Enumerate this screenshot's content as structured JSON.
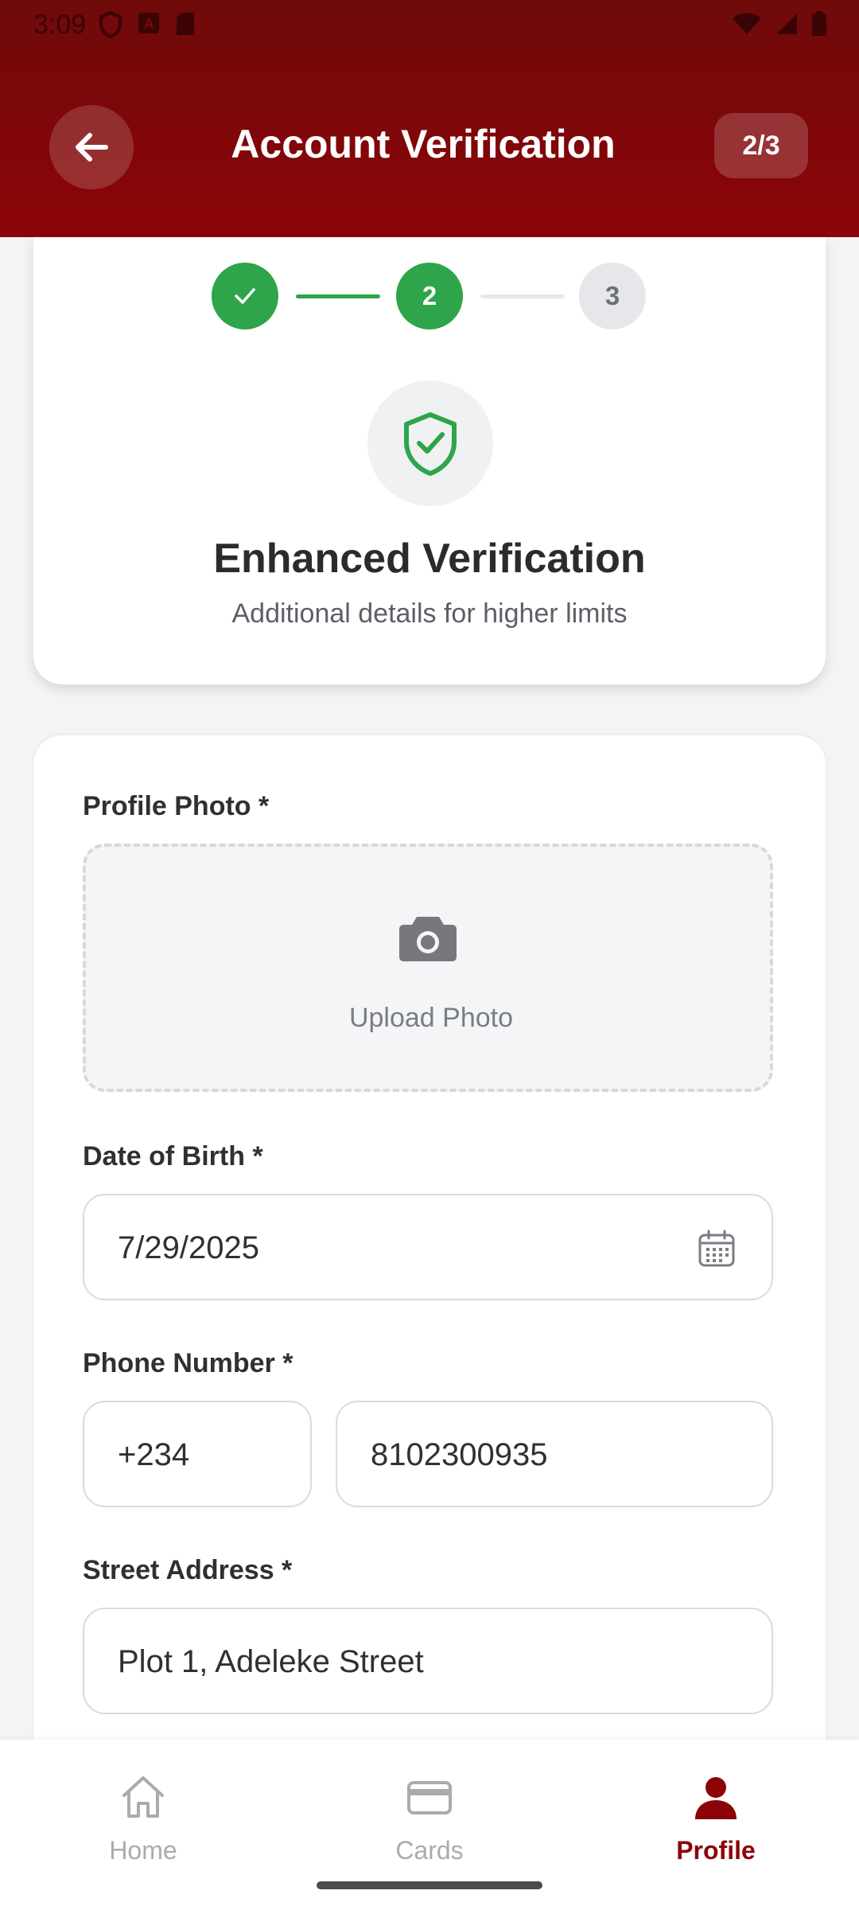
{
  "status_bar": {
    "time": "3:09"
  },
  "header": {
    "title": "Account Verification",
    "step_badge": "2/3"
  },
  "stepper": {
    "steps": [
      {
        "label": "",
        "state": "done"
      },
      {
        "label": "2",
        "state": "active"
      },
      {
        "label": "3",
        "state": "todo"
      }
    ]
  },
  "intro": {
    "title": "Enhanced Verification",
    "subtitle": "Additional details for higher limits"
  },
  "form": {
    "profile_photo_label": "Profile Photo *",
    "upload_label": "Upload Photo",
    "dob_label": "Date of Birth *",
    "dob_value": "7/29/2025",
    "phone_label": "Phone Number *",
    "phone_code": "+234",
    "phone_number": "8102300935",
    "address_label": "Street Address *",
    "address_value": "Plot 1, Adeleke Street"
  },
  "bottom_nav": {
    "items": [
      {
        "label": "Home",
        "icon": "home-icon"
      },
      {
        "label": "Cards",
        "icon": "card-icon"
      },
      {
        "label": "Profile",
        "icon": "profile-icon",
        "active": true
      }
    ]
  },
  "colors": {
    "brand": "#8c0408",
    "success": "#2ea54a"
  }
}
